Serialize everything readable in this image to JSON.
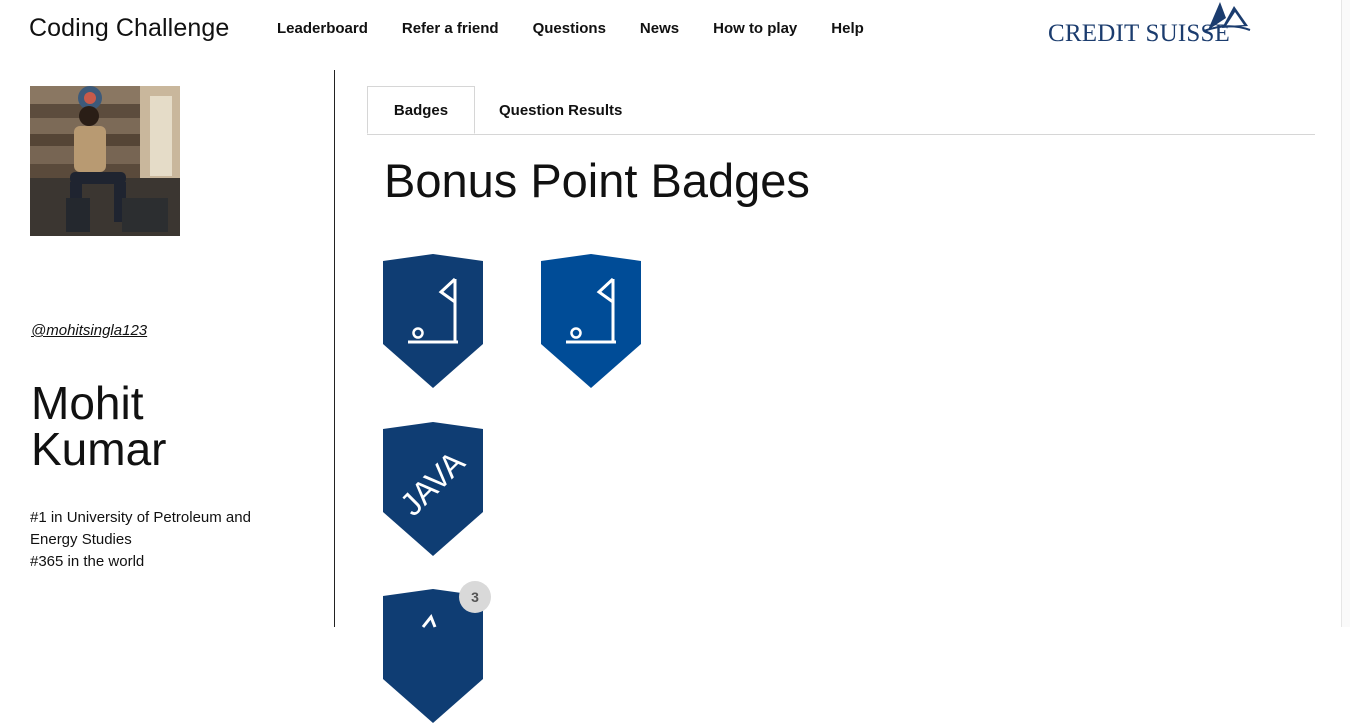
{
  "header": {
    "site_title": "Coding Challenge",
    "nav": [
      "Leaderboard",
      "Refer a friend",
      "Questions",
      "News",
      "How to play",
      "Help"
    ],
    "logo_text": "CREDIT SUISSE"
  },
  "profile": {
    "handle": "@mohitsingla123",
    "name": "Mohit Kumar",
    "rank_university": "#1 in University of Petroleum and Energy Studies",
    "rank_world": "#365 in the world"
  },
  "tabs": {
    "badges": "Badges",
    "question_results": "Question Results"
  },
  "section_title": "Bonus Point Badges",
  "badges": [
    {
      "icon": "golf-flag-icon",
      "color": "#0f3d73"
    },
    {
      "icon": "golf-flag-icon",
      "color": "#004c97"
    },
    {
      "icon": "java-icon",
      "text": "JAVA",
      "color": "#0f3d73"
    },
    {
      "icon": "badge-icon",
      "color": "#0f3d73",
      "count": "3"
    }
  ],
  "colors": {
    "brand": "#1b3c6e",
    "badge_dark": "#0f3d73",
    "badge_light": "#004c97"
  }
}
